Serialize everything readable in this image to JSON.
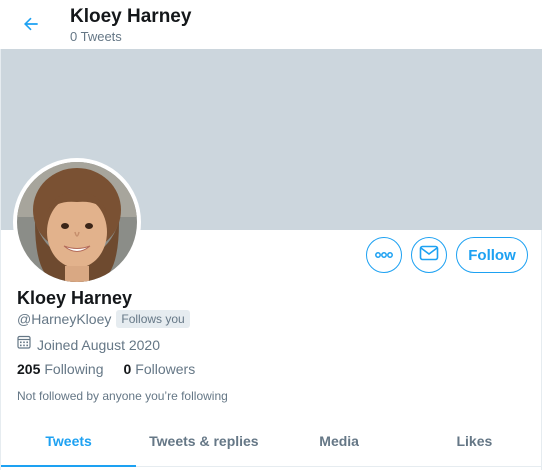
{
  "header": {
    "name": "Kloey Harney",
    "tweet_count": "0 Tweets"
  },
  "profile": {
    "name": "Kloey Harney",
    "handle": "@HarneyKloey",
    "follows_you": "Follows you",
    "joined": "Joined August 2020",
    "following_count": "205",
    "following_label": "Following",
    "followers_count": "0",
    "followers_label": "Followers",
    "not_followed_note": "Not followed by anyone you’re following"
  },
  "actions": {
    "follow_label": "Follow"
  },
  "tabs": [
    {
      "label": "Tweets",
      "active": true
    },
    {
      "label": "Tweets & replies",
      "active": false
    },
    {
      "label": "Media",
      "active": false
    },
    {
      "label": "Likes",
      "active": false
    }
  ],
  "colors": {
    "accent": "#1da1f2",
    "banner": "#ccd6dd",
    "secondary_text": "#657786"
  }
}
